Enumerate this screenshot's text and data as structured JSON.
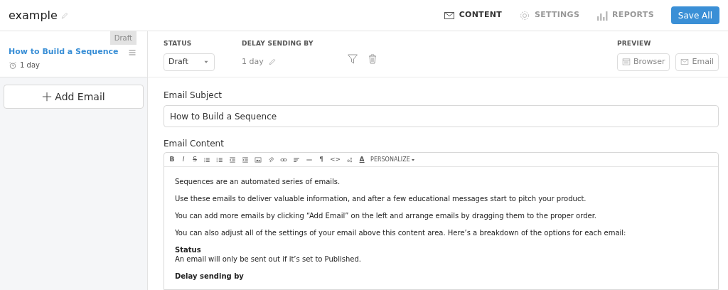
{
  "header": {
    "title": "example",
    "tabs": [
      {
        "label": "CONTENT",
        "selected": true
      },
      {
        "label": "SETTINGS",
        "selected": false
      },
      {
        "label": "REPORTS",
        "selected": false
      }
    ],
    "save_button": "Save All"
  },
  "sidebar": {
    "emails": [
      {
        "title": "How to Build a Sequence",
        "delay": "1 day",
        "badge": "Draft",
        "selected": true
      }
    ],
    "add_button": "Add Email"
  },
  "settings": {
    "status_label": "STATUS",
    "status_value": "Draft",
    "delay_label": "DELAY SENDING BY",
    "delay_value": "1 day",
    "preview_label": "PREVIEW",
    "preview_buttons": [
      "Browser",
      "Email"
    ]
  },
  "subject": {
    "label": "Email Subject",
    "value": "How to Build a Sequence"
  },
  "content": {
    "label": "Email Content",
    "toolbar": [
      {
        "kind": "glyph",
        "text": "B"
      },
      {
        "kind": "glyph",
        "text": "I"
      },
      {
        "kind": "glyph",
        "text": "S"
      },
      {
        "kind": "icon"
      },
      {
        "kind": "icon"
      },
      {
        "kind": "icon"
      },
      {
        "kind": "icon"
      },
      {
        "kind": "icon"
      },
      {
        "kind": "icon"
      },
      {
        "kind": "icon"
      },
      {
        "kind": "icon"
      },
      {
        "kind": "icon"
      },
      {
        "kind": "glyph",
        "text": "¶"
      },
      {
        "kind": "glyph",
        "text": "<>"
      },
      {
        "kind": "icon"
      },
      {
        "kind": "glyph",
        "text": "A"
      },
      {
        "kind": "menu",
        "text": "PERSONALIZE"
      }
    ],
    "blocks": [
      {
        "kind": "para",
        "text": "Sequences are an automated series of emails."
      },
      {
        "kind": "para",
        "text": "Use these emails to deliver valuable information, and after a few educational messages start to pitch your product."
      },
      {
        "kind": "para",
        "text": "You can add more emails by clicking “Add Email” on the left and arrange emails by dragging them to the proper order."
      },
      {
        "kind": "para",
        "text": "You can also adjust all of the settings of your email above this content area. Here’s a breakdown of the options for each email:"
      },
      {
        "kind": "heading",
        "text": "Status",
        "desc": "An email will only be sent out if it’s set to Published."
      },
      {
        "kind": "heading",
        "text": "Delay sending by"
      }
    ]
  }
}
